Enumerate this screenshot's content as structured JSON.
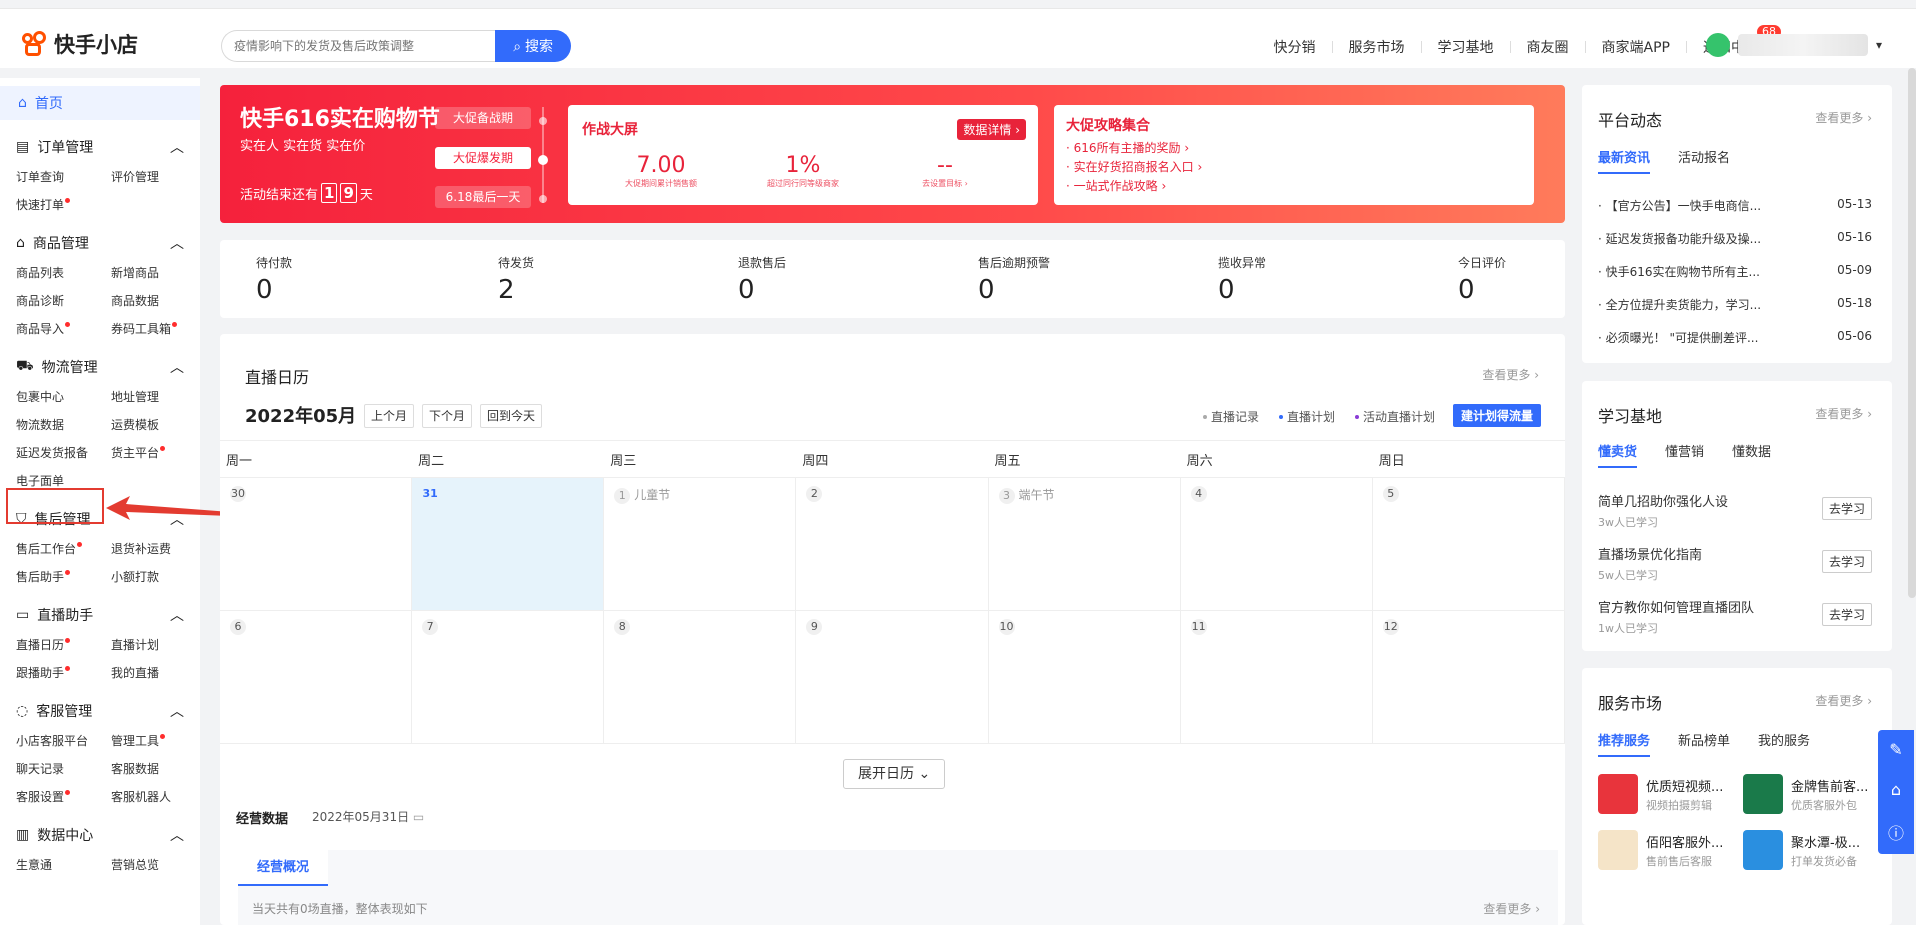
{
  "app": {
    "name": "快手小店"
  },
  "search": {
    "placeholder": "疫情影响下的发货及售后政策调整",
    "button": "搜索"
  },
  "topnav": {
    "items": [
      "快分销",
      "服务市场",
      "学习基地",
      "商友圈",
      "商家端APP",
      "通知中心"
    ],
    "notify_badge": "68"
  },
  "sidebar": {
    "home": "首页",
    "groups": [
      {
        "title": "订单管理",
        "items": [
          "订单查询",
          "评价管理",
          "快速打单"
        ]
      },
      {
        "title": "商品管理",
        "items": [
          "商品列表",
          "新增商品",
          "商品诊断",
          "商品数据",
          "商品导入",
          "券码工具箱"
        ]
      },
      {
        "title": "物流管理",
        "items": [
          "包裹中心",
          "地址管理",
          "物流数据",
          "运费模板",
          "延迟发货报备",
          "货主平台",
          "电子面单"
        ]
      },
      {
        "title": "售后管理",
        "items": [
          "售后工作台",
          "退货补运费",
          "售后助手",
          "小额打款"
        ]
      },
      {
        "title": "直播助手",
        "items": [
          "直播日历",
          "直播计划",
          "跟播助手",
          "我的直播"
        ]
      },
      {
        "title": "客服管理",
        "items": [
          "小店客服平台",
          "管理工具",
          "聊天记录",
          "客服数据",
          "客服设置",
          "客服机器人"
        ]
      },
      {
        "title": "数据中心",
        "items": [
          "生意通",
          "营销总览"
        ]
      }
    ]
  },
  "banner": {
    "title": "快手616实在购物节",
    "subtitle": "实在人 实在货 实在价",
    "countdown_prefix": "活动结束还有",
    "countdown_d1": "1",
    "countdown_d2": "9",
    "countdown_suffix": "天",
    "phases": [
      "大促备战期",
      "大促爆发期",
      "6.18最后一天"
    ],
    "card1": {
      "title": "作战大屏",
      "button": "数据详情 ›",
      "stats": [
        {
          "value": "7.00",
          "label": "大促期间累计销售额"
        },
        {
          "value": "1%",
          "label": "超过同行同等级商家"
        },
        {
          "value": "--",
          "label": "去设置目标 ›"
        }
      ]
    },
    "card2": {
      "title": "大促攻略集合",
      "links": [
        "· 616所有主播的奖励 ›",
        "· 实在好货招商报名入口 ›",
        "· 一站式作战攻略 ›"
      ]
    }
  },
  "orders": [
    {
      "label": "待付款",
      "value": "0"
    },
    {
      "label": "待发货",
      "value": "2"
    },
    {
      "label": "退款售后",
      "value": "0"
    },
    {
      "label": "售后逾期预警",
      "value": "0"
    },
    {
      "label": "揽收异常",
      "value": "0"
    },
    {
      "label": "今日评价",
      "value": "0"
    }
  ],
  "calendar": {
    "title": "直播日历",
    "more": "查看更多 ›",
    "month": "2022年05月",
    "buttons": [
      "上个月",
      "下个月",
      "回到今天"
    ],
    "legend": [
      "直播记录",
      "直播计划",
      "活动直播计划"
    ],
    "plan_button": "建计划得流量",
    "weekdays": [
      "周一",
      "周二",
      "周三",
      "周四",
      "周五",
      "周六",
      "周日"
    ],
    "week1": [
      {
        "d": "30",
        "note": ""
      },
      {
        "d": "31",
        "note": ""
      },
      {
        "d": "1",
        "note": "儿童节"
      },
      {
        "d": "2",
        "note": ""
      },
      {
        "d": "3",
        "note": "端午节"
      },
      {
        "d": "4",
        "note": ""
      },
      {
        "d": "5",
        "note": ""
      }
    ],
    "week2": [
      {
        "d": "6",
        "note": ""
      },
      {
        "d": "7",
        "note": ""
      },
      {
        "d": "8",
        "note": ""
      },
      {
        "d": "9",
        "note": ""
      },
      {
        "d": "10",
        "note": ""
      },
      {
        "d": "11",
        "note": ""
      },
      {
        "d": "12",
        "note": ""
      }
    ],
    "expand": "展开日历 ⌄"
  },
  "business": {
    "title": "经营数据",
    "date": "2022年05月31日",
    "tab": "经营概况",
    "desc": "当天共有0场直播，整体表现如下",
    "more": "查看更多 ›"
  },
  "platform": {
    "title": "平台动态",
    "more": "查看更多 ›",
    "tabs": [
      "最新资讯",
      "活动报名"
    ],
    "news": [
      {
        "t": "· 【官方公告】一快手电商信...",
        "d": "05-13"
      },
      {
        "t": "· 延迟发货报备功能升级及操...",
        "d": "05-16"
      },
      {
        "t": "· 快手616实在购物节所有主...",
        "d": "05-09"
      },
      {
        "t": "· 全方位提升卖货能力，学习...",
        "d": "05-18"
      },
      {
        "t": "· 必须曝光！ \"可提供删差评...",
        "d": "05-06"
      }
    ]
  },
  "learning": {
    "title": "学习基地",
    "more": "查看更多 ›",
    "tabs": [
      "懂卖货",
      "懂营销",
      "懂数据"
    ],
    "items": [
      {
        "t": "简单几招助你强化人设",
        "c": "3w人已学习",
        "b": "去学习"
      },
      {
        "t": "直播场景优化指南",
        "c": "5w人已学习",
        "b": "去学习"
      },
      {
        "t": "官方教你如何管理直播团队",
        "c": "1w人已学习",
        "b": "去学习"
      }
    ]
  },
  "market": {
    "title": "服务市场",
    "more": "查看更多 ›",
    "tabs": [
      "推荐服务",
      "新品榜单",
      "我的服务"
    ],
    "items": [
      {
        "t": "优质短视频...",
        "s": "视频拍摄剪辑",
        "color": "#e8343c"
      },
      {
        "t": "金牌售前客...",
        "s": "优质客服外包",
        "color": "#1a7a4a"
      },
      {
        "t": "佰阳客服外...",
        "s": "售前售后客服",
        "color": "#f5e4c8"
      },
      {
        "t": "聚水潭-极...",
        "s": "打单发货必备",
        "color": "#2a8fe0"
      }
    ]
  },
  "colors": {
    "accent": "#326bfb",
    "banner": "#f5213c",
    "highlight": "#e33b30"
  }
}
